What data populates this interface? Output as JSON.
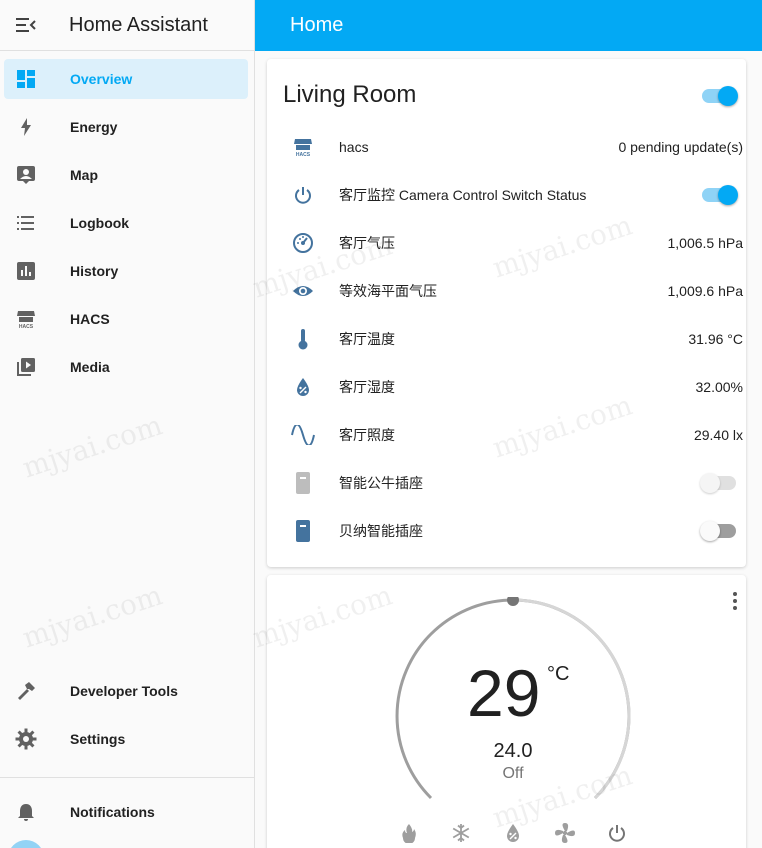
{
  "app": {
    "title": "Home Assistant"
  },
  "header": {
    "title": "Home"
  },
  "sidebar": {
    "items": [
      {
        "label": "Overview",
        "icon": "view-dashboard-icon",
        "active": true
      },
      {
        "label": "Energy",
        "icon": "lightning-bolt-icon"
      },
      {
        "label": "Map",
        "icon": "account-box-icon"
      },
      {
        "label": "Logbook",
        "icon": "format-list-bulleted-icon"
      },
      {
        "label": "History",
        "icon": "chart-box-icon"
      },
      {
        "label": "HACS",
        "icon": "hacs-icon"
      },
      {
        "label": "Media",
        "icon": "play-box-multiple-icon"
      }
    ],
    "bottom_items": [
      {
        "label": "Developer Tools",
        "icon": "hammer-icon"
      },
      {
        "label": "Settings",
        "icon": "cog-icon"
      }
    ],
    "notifications": {
      "label": "Notifications",
      "icon": "bell-icon"
    }
  },
  "living_room": {
    "title": "Living Room",
    "master_toggle": "on",
    "rows": [
      {
        "name": "hacs",
        "value": "0 pending update(s)",
        "icon": "hacs-icon"
      },
      {
        "name": "客厅监控 Camera Control Switch Status",
        "value": "",
        "icon": "power-icon",
        "toggle": "on"
      },
      {
        "name": "客厅气压",
        "value": "1,006.5 hPa",
        "icon": "gauge-icon"
      },
      {
        "name": "等效海平面气压",
        "value": "1,009.6 hPa",
        "icon": "eye-icon"
      },
      {
        "name": "客厅温度",
        "value": "31.96 °C",
        "icon": "thermometer-icon"
      },
      {
        "name": "客厅湿度",
        "value": "32.00%",
        "icon": "water-percent-icon"
      },
      {
        "name": "客厅照度",
        "value": "29.40 lx",
        "icon": "sine-wave-icon"
      },
      {
        "name": "智能公牛插座",
        "value": "",
        "icon": "power-socket-icon",
        "toggle": "disabled"
      },
      {
        "name": "贝纳智能插座",
        "value": "",
        "icon": "power-socket-icon",
        "toggle": "off"
      }
    ]
  },
  "thermostat": {
    "current_temp": "29",
    "unit": "°C",
    "target": "24.0",
    "state": "Off",
    "modes": [
      "fire-icon",
      "snowflake-icon",
      "water-percent-icon",
      "fan-icon",
      "power-icon"
    ]
  },
  "watermark": "mjyai.com",
  "colors": {
    "accent": "#03a9f4",
    "icon": "#44739e"
  }
}
